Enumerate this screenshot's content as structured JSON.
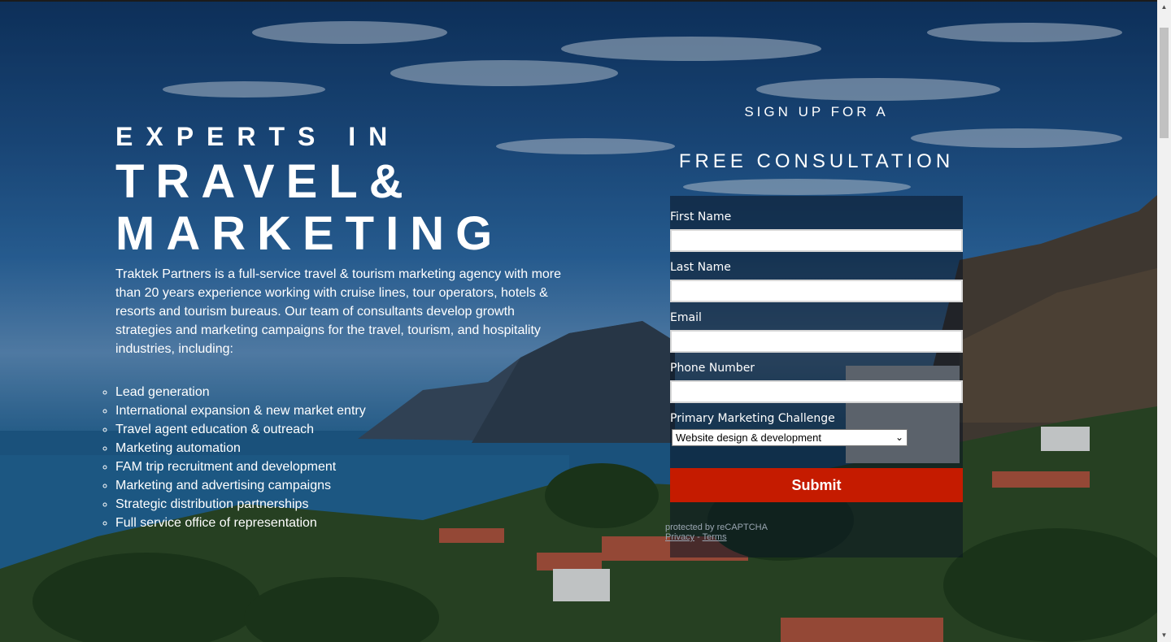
{
  "hero": {
    "kicker": "EXPERTS IN",
    "title_line1": "TRAVEL&",
    "title_line2": "MARKETING",
    "description": "Traktek Partners is a full-service travel & tourism marketing agency with more than 20 years experience working with cruise lines, tour operators, hotels & resorts and tourism bureaus. Our team of consultants develop growth strategies and marketing campaigns for the travel, tourism, and hospitality industries, including:",
    "services": [
      "Lead generation",
      "International expansion & new market entry",
      "Travel agent education & outreach",
      "Marketing automation",
      "FAM trip recruitment and development",
      "Marketing and advertising campaigns",
      "Strategic distribution partnerships",
      "Full service office of representation"
    ]
  },
  "signup": {
    "kicker": "SIGN UP FOR A",
    "title": "FREE CONSULTATION"
  },
  "form": {
    "first_name_label": "First Name",
    "last_name_label": "Last Name",
    "email_label": "Email",
    "phone_label": "Phone Number",
    "challenge_label": "Primary Marketing Challenge",
    "challenge_selected": "Website design & development",
    "first_name_value": "",
    "last_name_value": "",
    "email_value": "",
    "phone_value": "",
    "submit_label": "Submit"
  },
  "recaptcha": {
    "text": "protected by reCAPTCHA",
    "privacy": "Privacy",
    "separator": " - ",
    "terms": "Terms"
  },
  "colors": {
    "submit_bg": "#c51b00",
    "form_overlay": "rgba(10,20,35,0.55)"
  },
  "icons": {
    "select_arrow": "chevron-down-icon",
    "scroll_up": "triangle-up-icon",
    "scroll_down": "triangle-down-icon"
  }
}
